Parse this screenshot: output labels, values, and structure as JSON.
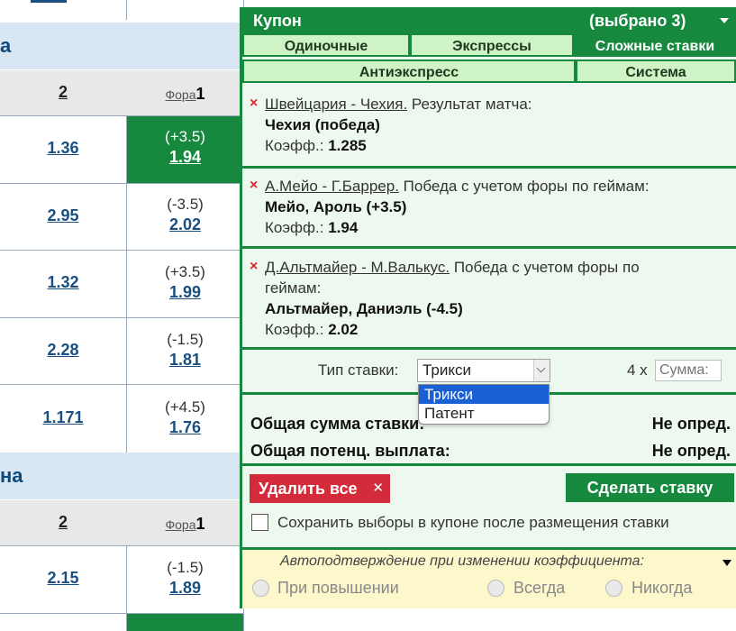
{
  "background": {
    "sections": [
      "а",
      "на"
    ],
    "col_head_2": "2",
    "col_head_fora_link": "Фора",
    "col_head_fora_num": "1",
    "rows": [
      {
        "odd": "1.36",
        "handicap": "(+3.5)",
        "value": "1.94",
        "selected": true
      },
      {
        "odd": "2.95",
        "handicap": "(-3.5)",
        "value": "2.02",
        "selected": false
      },
      {
        "odd": "1.32",
        "handicap": "(+3.5)",
        "value": "1.99",
        "selected": false
      },
      {
        "odd": "2.28",
        "handicap": "(-1.5)",
        "value": "1.81",
        "selected": false
      },
      {
        "odd": "1.171",
        "handicap": "(+4.5)",
        "value": "1.76",
        "selected": false
      },
      {
        "odd": "2.15",
        "handicap": "(-1.5)",
        "value": "1.89",
        "selected": false
      }
    ]
  },
  "coupon": {
    "title": "Купон",
    "selected_count": "(выбрано 3)",
    "tabs": {
      "single": "Одиночные",
      "express": "Экспрессы",
      "complex": "Сложные ставки",
      "anti": "Антиэкспресс",
      "system": "Система"
    },
    "bets": [
      {
        "event": "Швейцария - Чехия.",
        "market": " Результат матча:",
        "pick": "Чехия (победа)",
        "coef_label": "Коэфф.: ",
        "coef": "1.285"
      },
      {
        "event": "А.Мейо - Г.Баррер.",
        "market": " Победа с учетом форы по геймам:",
        "pick": "Мейо, Ароль (+3.5)",
        "coef_label": "Коэфф.: ",
        "coef": "1.94"
      },
      {
        "event": "Д.Альтмайер - М.Валькус.",
        "market": " Победа с учетом форы по",
        "market2": "геймам:",
        "pick": "Альтмайер, Даниэль (-4.5)",
        "coef_label": "Коэфф.: ",
        "coef": "2.02"
      }
    ],
    "bet_type_label": "Тип ставки:",
    "bet_type_value": "Трикси",
    "bet_type_options": [
      "Трикси",
      "Патент"
    ],
    "multiplier": "4 x",
    "sum_placeholder": "Сумма:",
    "total_label": "Общая сумма ставки:",
    "total_value": "Не опред.",
    "payout_label": "Общая потенц. выплата:",
    "payout_value": "Не опред.",
    "delete_all": "Удалить все",
    "make_bet": "Сделать ставку",
    "save_label": "Сохранить выборы в купоне после размещения ставки",
    "auto_confirm_title": "Автоподтверждение при изменении коэффициента:",
    "auto_options": [
      "При повышении",
      "Всегда",
      "Никогда"
    ]
  }
}
